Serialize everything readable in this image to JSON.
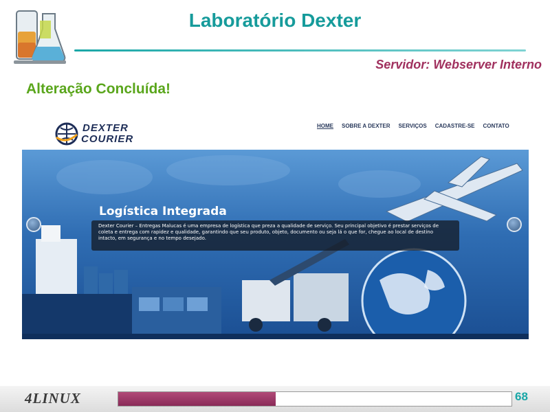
{
  "slide": {
    "title": "Laboratório Dexter",
    "server_label": "Servidor: Webserver Interno",
    "status_heading": "Alteração Concluída!",
    "page_number": "68",
    "progress_fraction": 0.4
  },
  "footer": {
    "brand": "4LINUX"
  },
  "site": {
    "logo_line1": "DEXTER",
    "logo_line2": "COURIER",
    "nav": [
      "HOME",
      "SOBRE A DEXTER",
      "SERVIÇOS",
      "CADASTRE-SE",
      "CONTATO"
    ],
    "active_nav": "HOME",
    "hero_title": "Logística Integrada",
    "hero_text": "Dexter Courier – Entregas Malucas é uma empresa de logística que preza a qualidade de serviço. Seu principal objetivo é prestar serviços de coleta e entrega com rapidez e qualidade, garantindo que seu produto, objeto, documento ou seja lá o que for, chegue ao local de destino intacto, em segurança e no tempo desejado."
  },
  "colors": {
    "title": "#169b9b",
    "server": "#a0305e",
    "status": "#5aa61c",
    "progress": "#9a3565"
  }
}
